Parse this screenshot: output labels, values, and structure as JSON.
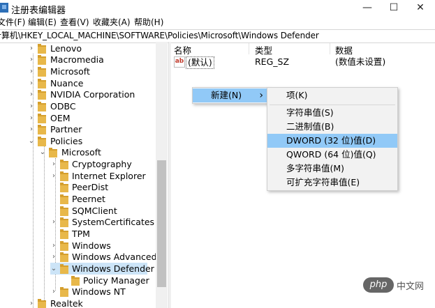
{
  "window": {
    "title": "注册表编辑器",
    "minimize": "—",
    "maximize": "☐",
    "close": "✕"
  },
  "menu": [
    "文件(F)",
    "编辑(E)",
    "查看(V)",
    "收藏夹(A)",
    "帮助(H)"
  ],
  "address": "计算机\\HKEY_LOCAL_MACHINE\\SOFTWARE\\Policies\\Microsoft\\Windows Defender",
  "tree": [
    "Lenovo",
    "Macromedia",
    "Microsoft",
    "Nuance",
    "NVIDIA Corporation",
    "ODBC",
    "OEM",
    "Partner",
    "Policies",
    "Microsoft",
    "Cryptography",
    "Internet Explorer",
    "PeerDist",
    "Peernet",
    "SQMClient",
    "SystemCertificates",
    "TPM",
    "Windows",
    "Windows Advanced Ti",
    "Windows Defender",
    "Policy Manager",
    "Windows NT",
    "Realtek"
  ],
  "list": {
    "headers": {
      "name": "名称",
      "type": "类型",
      "data": "数据"
    },
    "rows": [
      {
        "name": "(默认)",
        "type": "REG_SZ",
        "data": "(数值未设置)"
      }
    ],
    "icon_text": "ab"
  },
  "context_menu": {
    "new_label": "新建(N)",
    "new_arrow": "›"
  },
  "submenu": [
    "项(K)",
    "字符串值(S)",
    "二进制值(B)",
    "DWORD (32 位)值(D)",
    "QWORD (64 位)值(Q)",
    "多字符串值(M)",
    "可扩充字符串值(E)"
  ],
  "watermark": {
    "badge": "php",
    "text": "中文网"
  },
  "colors": {
    "selection": "#cce4f7",
    "menu_highlight": "#91c9f7",
    "folder": "#e8b84a"
  }
}
